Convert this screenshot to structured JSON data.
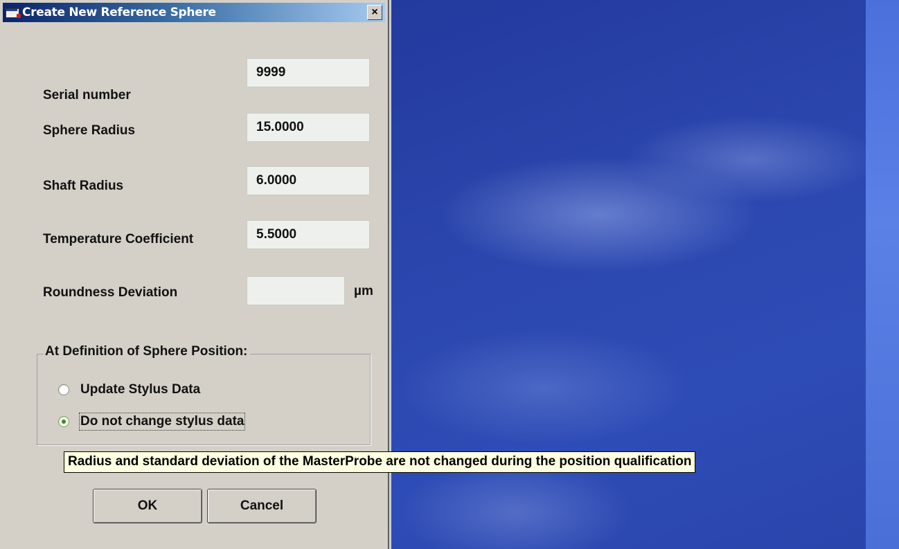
{
  "window": {
    "title": "Create New Reference Sphere",
    "close_label": "×"
  },
  "form": {
    "serial_label": "Serial number",
    "serial_value": "9999",
    "sphere_radius_label": "Sphere Radius",
    "sphere_radius_value": "15.0000",
    "shaft_radius_label": "Shaft Radius",
    "shaft_radius_value": "6.0000",
    "temp_coeff_label": "Temperature Coefficient",
    "temp_coeff_value": "5.5000",
    "roundness_label": "Roundness Deviation",
    "roundness_value": "",
    "roundness_unit": "µm"
  },
  "group": {
    "title": "At Definition of Sphere Position:",
    "options": [
      {
        "label": "Update Stylus Data",
        "checked": false
      },
      {
        "label": "Do not change stylus data",
        "checked": true
      }
    ]
  },
  "tooltip": "Radius and standard deviation of the MasterProbe are not changed during the position qualification",
  "buttons": {
    "ok": "OK",
    "cancel": "Cancel"
  }
}
